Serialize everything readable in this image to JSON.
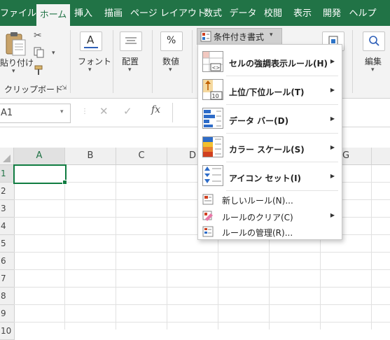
{
  "menu_tabs": [
    {
      "label": "ファイル"
    },
    {
      "label": "ホーム"
    },
    {
      "label": "挿入"
    },
    {
      "label": "描画"
    },
    {
      "label": "ページ レイアウト"
    },
    {
      "label": "数式"
    },
    {
      "label": "データ"
    },
    {
      "label": "校閲"
    },
    {
      "label": "表示"
    },
    {
      "label": "開発"
    },
    {
      "label": "ヘルプ"
    }
  ],
  "ribbon": {
    "paste_label": "貼り付け",
    "clipboard_group": "クリップボード",
    "font_label": "フォント",
    "align_label": "配置",
    "number_label": "数値",
    "cond_format_label": "条件付き書式",
    "edit_label": "編集"
  },
  "formula_bar": {
    "name_box": "A1",
    "fx": "fx"
  },
  "grid": {
    "columns": [
      "A",
      "B",
      "C",
      "D",
      "E",
      "F",
      "G"
    ],
    "rows": [
      "1",
      "2",
      "3",
      "4",
      "5",
      "6",
      "7",
      "8",
      "9",
      "10"
    ]
  },
  "dropdown": {
    "items": [
      {
        "label": "セルの強調表示ルール(H)",
        "icon": "highlight-rules-icon"
      },
      {
        "label": "上位/下位ルール(T)",
        "icon": "top-bottom-rules-icon"
      },
      {
        "label": "データ バー(D)",
        "icon": "data-bars-icon"
      },
      {
        "label": "カラー スケール(S)",
        "icon": "color-scales-icon"
      },
      {
        "label": "アイコン セット(I)",
        "icon": "icon-sets-icon"
      }
    ],
    "small_items": [
      {
        "label": "新しいルール(N)...",
        "icon": "new-rule-icon"
      },
      {
        "label": "ルールのクリア(C)",
        "icon": "clear-rules-icon"
      },
      {
        "label": "ルールの管理(R)...",
        "icon": "manage-rules-icon"
      }
    ]
  },
  "colors": {
    "excel_green": "#217346",
    "ribbon_bg": "#f3f3f3",
    "selection": "#107c41"
  }
}
